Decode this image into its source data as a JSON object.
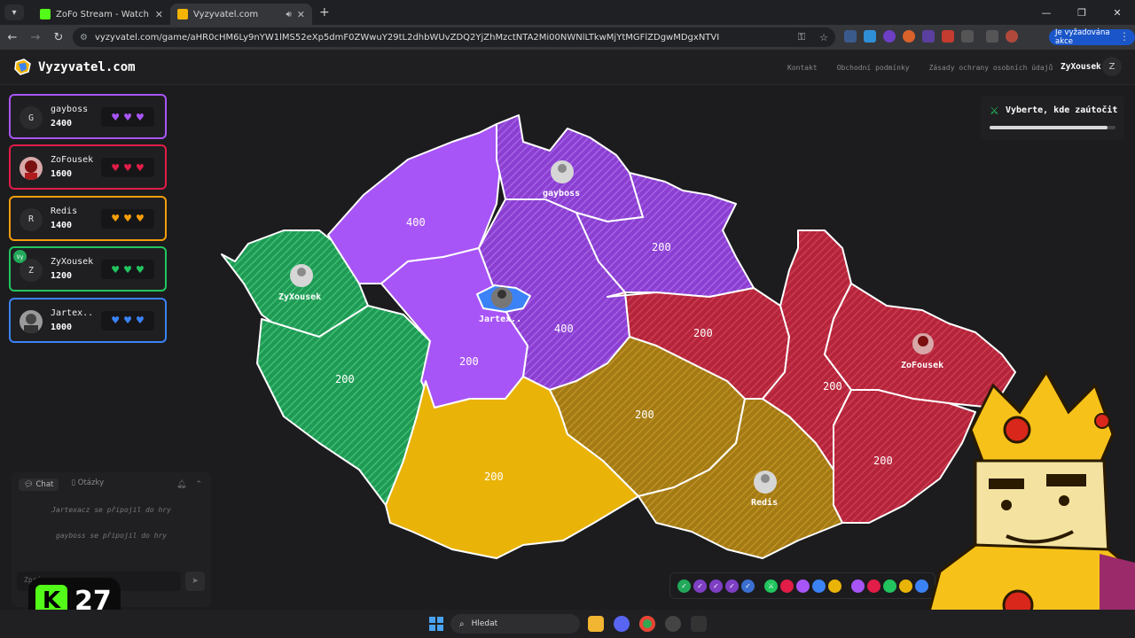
{
  "browser": {
    "tabs": [
      {
        "title": "ZoFo Stream - Watch Live on Ki",
        "favicon_color": "#53fc18",
        "active": false
      },
      {
        "title": "Vyzyvatel.com",
        "favicon_color": "#f5b400",
        "active": true
      }
    ],
    "address": "vyzyvatel.com/game/aHR0cHM6Ly9nYW1lMS52eXp5dmF0ZWwuY29tL2dhbWUvZDQ2YjZhMzctNTA2Mi00NWNlLTkwMjYtMGFlZDgwMDgxNTVI",
    "action_required": "Je vyžadována akce"
  },
  "site": {
    "logo": "Vyzyvatel.com",
    "links": [
      "Kontakt",
      "Obchodní podmínky",
      "Zásady ochrany osobních údajů"
    ],
    "user": {
      "name": "ZyXousek",
      "initial": "Z"
    }
  },
  "players": [
    {
      "name": "gayboss",
      "score": "2400",
      "initial": "G",
      "color": "#a855f7",
      "hearts": 3
    },
    {
      "name": "ZoFousek",
      "score": "1600",
      "initial": "",
      "color": "#e11d48",
      "hearts": 3
    },
    {
      "name": "Redis",
      "score": "1400",
      "initial": "R",
      "color": "#f59e0b",
      "hearts": 3
    },
    {
      "name": "ZyXousek",
      "score": "1200",
      "initial": "Z",
      "color": "#22c55e",
      "hearts": 3,
      "badge": "Vy"
    },
    {
      "name": "Jartex..",
      "score": "1000",
      "initial": "",
      "color": "#3b82f6",
      "hearts": 3
    }
  ],
  "chat": {
    "tabs": [
      "Chat",
      "Otázky"
    ],
    "messages": [
      "Jartexacz se připojil do hry",
      "gayboss se připojil do hry"
    ],
    "input_placeholder": "Zpráva"
  },
  "stream": {
    "kick_viewers": "27"
  },
  "game": {
    "instruction": "Vyberte, kde zaútočit",
    "timer_fraction": 0.94
  },
  "map_labels": {
    "r_nw_purple": "400",
    "r_center_purple": "400",
    "r_mid_purple": "200",
    "r_ne_purple": "200",
    "r_green_south": "200",
    "r_south_yellow": "200",
    "r_vys_gold": "200",
    "r_pardubice_red": "200",
    "r_olomouc_red": "200",
    "r_zlin_red": "200"
  },
  "map_pins": {
    "gayboss": "gayboss",
    "zyxousek": "ZyXousek",
    "jartex": "Jartex..",
    "zofousek": "ZoFousek",
    "redis": "Redis"
  },
  "taskbar": {
    "search": "Hledat"
  }
}
